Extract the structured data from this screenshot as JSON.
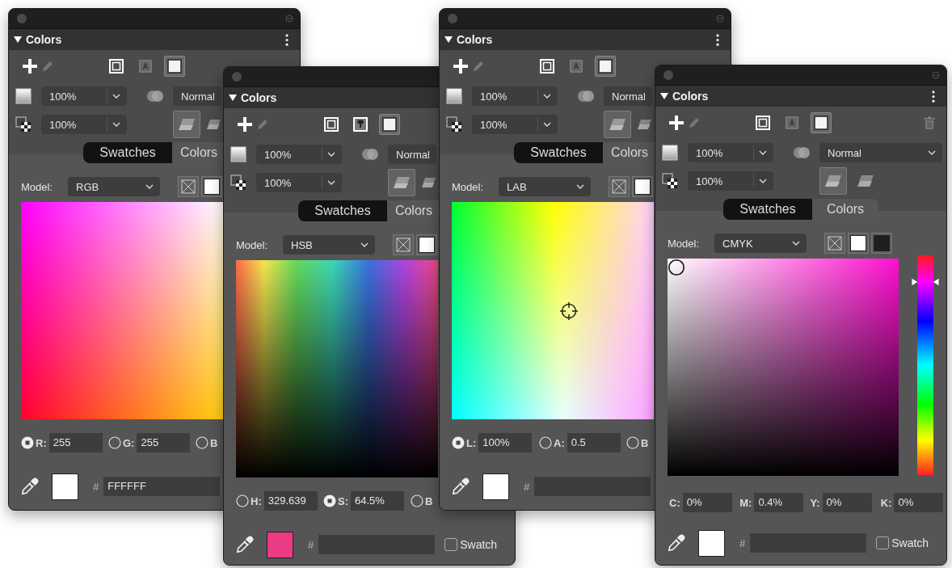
{
  "panels": [
    {
      "title": "Colors",
      "target_buttons": [
        {
          "kind": "stroke",
          "selected": false
        },
        {
          "kind": "text",
          "selected": false
        },
        {
          "kind": "fill",
          "selected": true
        }
      ],
      "fill_opacity": "100%",
      "blend_mode": "Normal",
      "layer_opacity": "100%",
      "blend_buttons": [
        {
          "selected": true
        },
        {
          "selected": false
        }
      ],
      "tabs": [
        {
          "label": "Swatches",
          "selected": false
        },
        {
          "label": "Colors",
          "selected": true
        }
      ],
      "model_label": "Model:",
      "model": "RGB",
      "kind": "rgb",
      "channels": [
        {
          "kind": "radio",
          "label": "R:",
          "value": "255",
          "selected": true
        },
        {
          "kind": "radio",
          "label": "G:",
          "value": "255",
          "selected": false
        },
        {
          "kind": "radio",
          "label": "B",
          "selected": false
        }
      ],
      "current_swatch": {
        "color": "#ffffff"
      },
      "hex_label": "#",
      "hex": "FFFFFF"
    },
    {
      "title": "Colors",
      "target_buttons": [
        {
          "kind": "stroke",
          "selected": false
        },
        {
          "kind": "image",
          "selected": false
        },
        {
          "kind": "fill",
          "selected": true
        }
      ],
      "fill_opacity": "100%",
      "blend_mode": "Normal",
      "layer_opacity": "100%",
      "blend_buttons": [
        {
          "selected": true
        },
        {
          "selected": false
        }
      ],
      "tabs": [
        {
          "label": "Swatches",
          "selected": false
        },
        {
          "label": "Colors",
          "selected": true
        }
      ],
      "model_label": "Model:",
      "model": "HSB",
      "kind": "hsb",
      "channels": [
        {
          "kind": "radio",
          "label": "H:",
          "value": "329.639",
          "selected": false
        },
        {
          "kind": "radio",
          "label": "S:",
          "value": "64.5%",
          "selected": true
        },
        {
          "kind": "radio",
          "label": "B",
          "selected": false
        }
      ],
      "current_swatch": {
        "color": "#ec3b84"
      },
      "hex_label": "#",
      "swatch_option": {
        "label": "Swatch",
        "checked": false
      }
    },
    {
      "title": "Colors",
      "target_buttons": [
        {
          "kind": "stroke",
          "selected": false
        },
        {
          "kind": "text",
          "selected": false
        },
        {
          "kind": "fill",
          "selected": true
        }
      ],
      "fill_opacity": "100%",
      "blend_mode": "Normal",
      "layer_opacity": "100%",
      "blend_buttons": [
        {
          "selected": true
        },
        {
          "selected": false
        }
      ],
      "tabs": [
        {
          "label": "Swatches",
          "selected": false
        },
        {
          "label": "Colors",
          "selected": true
        }
      ],
      "model_label": "Model:",
      "model": "LAB",
      "kind": "lab",
      "channels": [
        {
          "kind": "radio",
          "label": "L:",
          "value": "100%",
          "selected": true
        },
        {
          "kind": "radio",
          "label": "A:",
          "value": "0.5",
          "selected": false
        },
        {
          "kind": "radio",
          "label": "B",
          "selected": false
        }
      ],
      "current_swatch": {
        "color": "#ffffff"
      },
      "hex_label": "#"
    },
    {
      "title": "Colors",
      "target_buttons": [
        {
          "kind": "stroke",
          "selected": false
        },
        {
          "kind": "text",
          "selected": false
        },
        {
          "kind": "fill",
          "selected": true
        }
      ],
      "fill_opacity": "100%",
      "blend_mode": "Normal",
      "layer_opacity": "100%",
      "blend_buttons": [
        {
          "selected": true
        },
        {
          "selected": false
        }
      ],
      "tabs": [
        {
          "label": "Swatches",
          "selected": false
        },
        {
          "label": "Colors",
          "selected": true
        }
      ],
      "model_label": "Model:",
      "model": "CMYK",
      "kind": "cmyk",
      "hue_slider": {
        "level": 0.88
      },
      "channels": [
        {
          "kind": "plain",
          "label": "C:",
          "value": "0%"
        },
        {
          "kind": "plain",
          "label": "M:",
          "value": "0.4%"
        },
        {
          "kind": "plain",
          "label": "Y:",
          "value": "0%"
        },
        {
          "kind": "plain",
          "label": "K:",
          "value": "0%"
        }
      ],
      "current_swatch": {
        "color": "#ffffff"
      },
      "hex_label": "#",
      "swatch_option": {
        "label": "Swatch",
        "checked": false
      }
    }
  ]
}
